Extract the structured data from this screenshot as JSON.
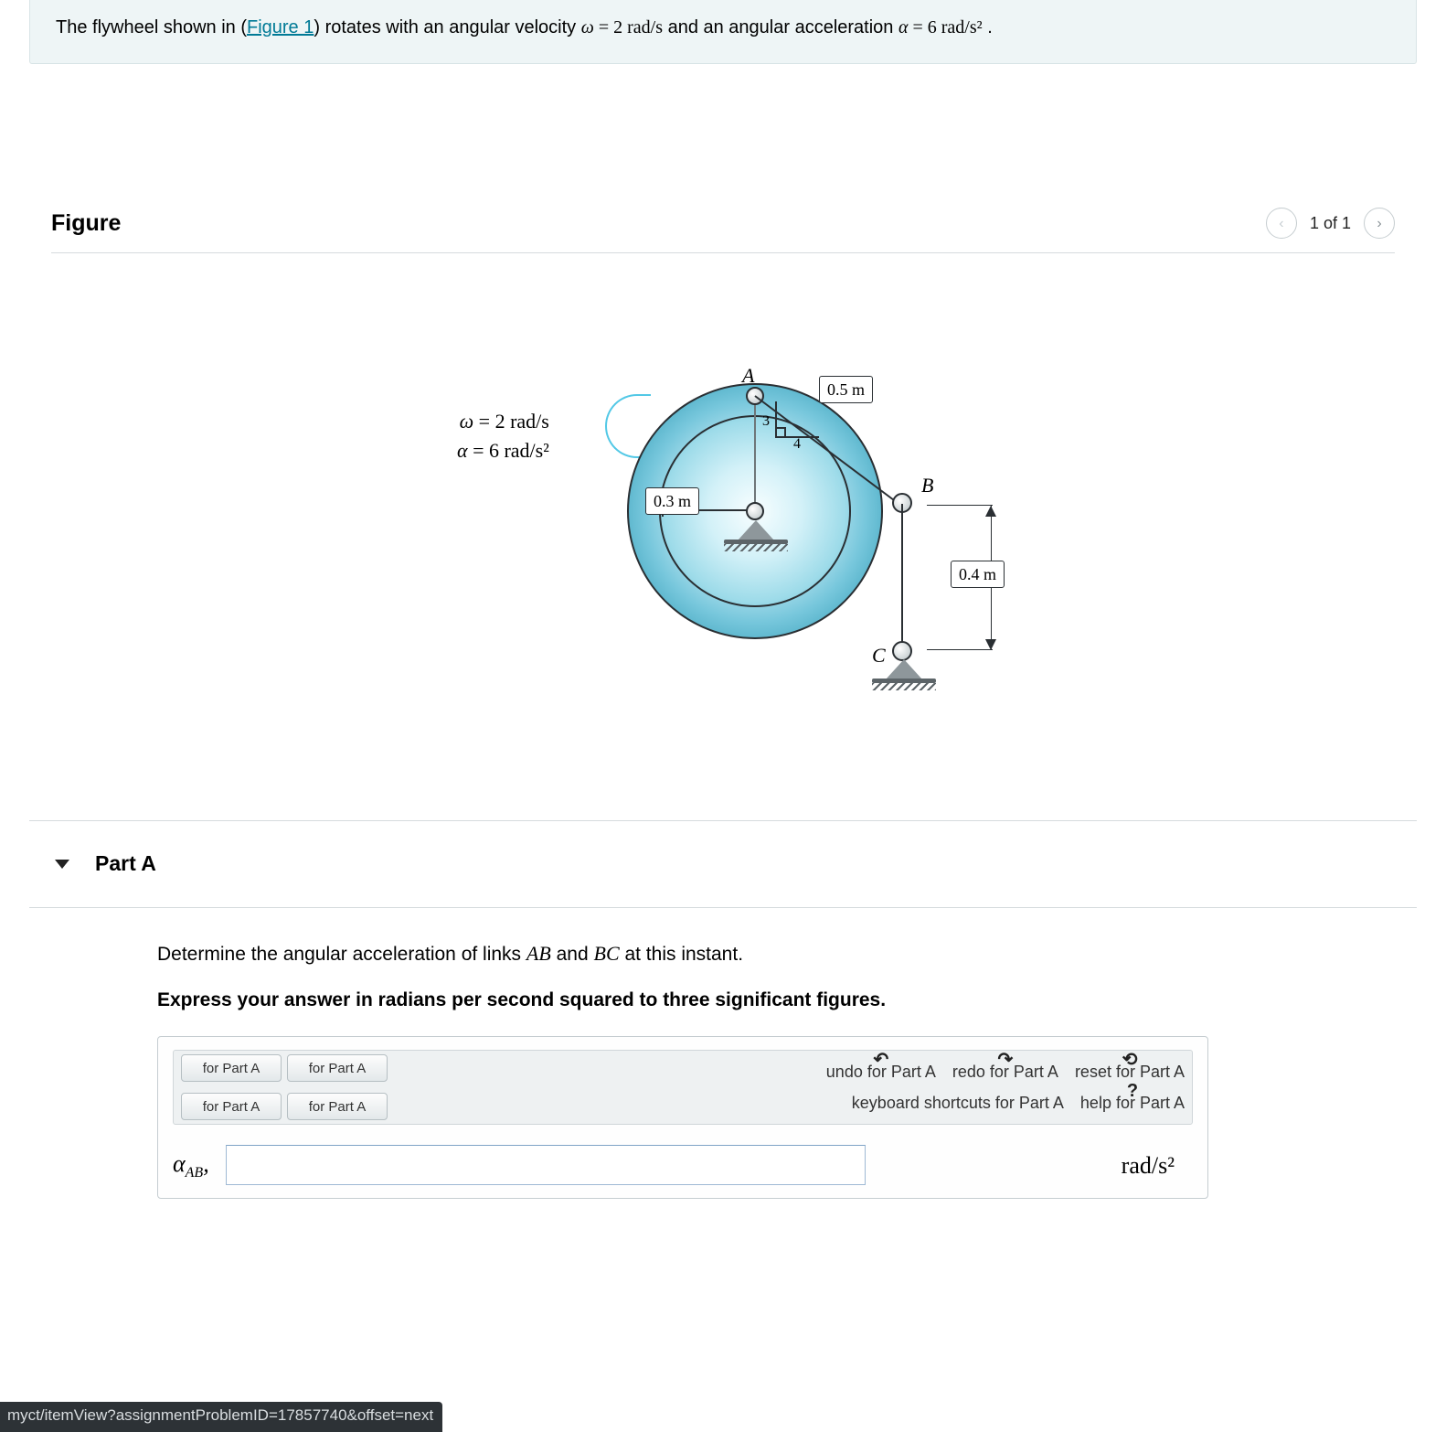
{
  "problem": {
    "prefix": "The flywheel shown in (",
    "figure_link": "Figure 1",
    "middle1": ") rotates with an angular velocity ",
    "omega_expr": "ω = 2 rad/s",
    "middle2": " and an angular acceleration ",
    "alpha_expr": "α = 6 rad/s²",
    "suffix": " ."
  },
  "figure": {
    "heading": "Figure",
    "pager_text": "1 of 1",
    "params": {
      "line1": "ω = 2 rad/s",
      "line2": "α = 6 rad/s²"
    },
    "labels": {
      "A": "A",
      "B": "B",
      "C": "C",
      "r": "0.3 m",
      "ab": "0.5 m",
      "bc": "0.4 m",
      "tri_v": "3",
      "tri_h": "4"
    }
  },
  "partA": {
    "title": "Part A",
    "prompt_pre": "Determine the angular acceleration of links ",
    "link1": "AB",
    "prompt_mid": " and ",
    "link2": "BC",
    "prompt_post": " at this instant.",
    "hint": "Express your answer in radians per second squared to three significant figures.",
    "toolbar": {
      "btn1": "for Part A",
      "btn2": "for Part A",
      "btn3": "for Part A",
      "btn4": "for Part A",
      "undo": "undo for Part A",
      "redo": "redo for Part A",
      "reset": "reset for Part A",
      "kb": "keyboard shortcuts for Part A",
      "help": "help for Part A"
    },
    "answer": {
      "var": "α",
      "sub": "AB",
      "comma": ",",
      "value": "",
      "unit": "rad/s²"
    }
  },
  "statusbar": "myct/itemView?assignmentProblemID=17857740&offset=next"
}
